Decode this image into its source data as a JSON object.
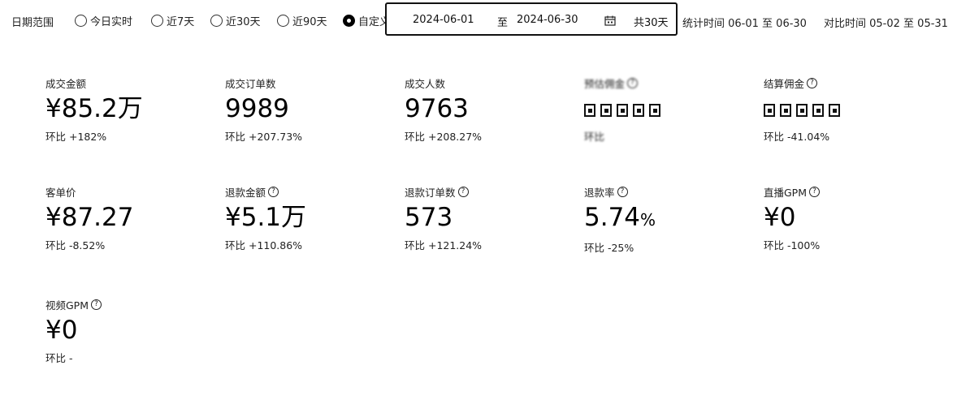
{
  "filter": {
    "label": "日期范围",
    "options": [
      {
        "label": "今日实时",
        "selected": false
      },
      {
        "label": "近7天",
        "selected": false
      },
      {
        "label": "近30天",
        "selected": false
      },
      {
        "label": "近90天",
        "selected": false
      },
      {
        "label": "自定义",
        "selected": true
      }
    ],
    "date_start": "2024-06-01",
    "date_separator": "至",
    "date_end": "2024-06-30",
    "calendar_icon": "calendar-icon",
    "total_days": "共30天",
    "stat_time": "统计时间 06-01 至 06-30",
    "compare_time": "对比时间 05-02 至 05-31"
  },
  "metrics": [
    {
      "title": "成交金额",
      "value": "¥85.2万",
      "delta": "环比 +182%",
      "help": false
    },
    {
      "title": "成交订单数",
      "value": "9989",
      "delta": "环比 +207.73%",
      "help": false
    },
    {
      "title": "成交人数",
      "value": "9763",
      "delta": "环比 +208.27%",
      "help": false
    },
    {
      "title": "预估佣金",
      "value": "",
      "delta": "环比",
      "help": true,
      "obscured": true
    },
    {
      "title": "结算佣金",
      "value": "",
      "delta": "环比 -41.04%",
      "help": true,
      "obscured": true
    },
    {
      "title": "客单价",
      "value": "¥87.27",
      "delta": "环比 -8.52%",
      "help": false
    },
    {
      "title": "退款金额",
      "value": "¥5.1万",
      "delta": "环比 +110.86%",
      "help": true
    },
    {
      "title": "退款订单数",
      "value": "573",
      "delta": "环比 +121.24%",
      "help": true
    },
    {
      "title": "退款率",
      "value": "5.74",
      "unit": "%",
      "delta": "环比 -25%",
      "help": true
    },
    {
      "title": "直播GPM",
      "value": "¥0",
      "delta": "环比 -100%",
      "help": true
    },
    {
      "title": "视频GPM",
      "value": "¥0",
      "delta": "环比 -",
      "help": true
    }
  ],
  "help_glyph": "?"
}
